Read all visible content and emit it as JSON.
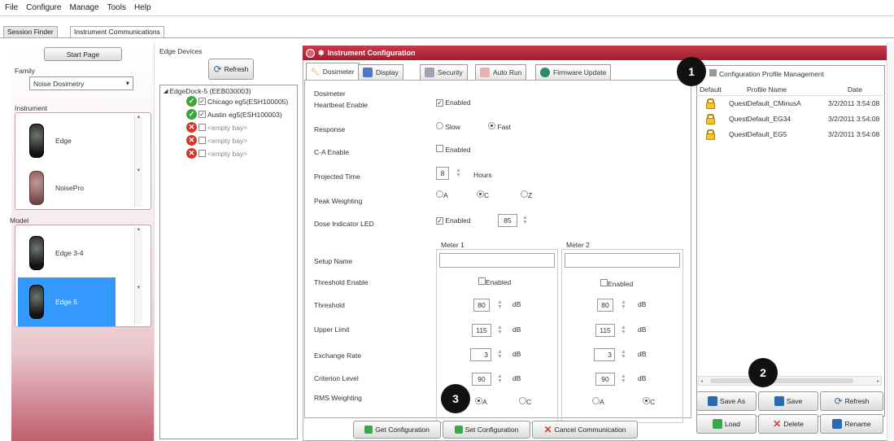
{
  "menu": [
    "File",
    "Configure",
    "Manage",
    "Tools",
    "Help"
  ],
  "tabs": {
    "session_finder": "Session Finder",
    "instrument_comm": "Instrument Communications"
  },
  "left": {
    "start_page": "Start Page",
    "family_label": "Family",
    "family_value": "Noise Dosimetry",
    "instrument_label": "Instrument",
    "instruments": [
      "Edge",
      "NoisePro"
    ],
    "model_label": "Model",
    "models": [
      "Edge 3-4",
      "Edge 5"
    ]
  },
  "edge": {
    "title": "Edge Devices",
    "refresh": "Refresh",
    "dock": "EdgeDock-5 (EEB030003)",
    "bays": [
      {
        "label": "Chicago eg5(ESH100005)",
        "status": "ok",
        "checked": true
      },
      {
        "label": "Austin eg5(ESH100003)",
        "status": "ok",
        "checked": true
      },
      {
        "label": "<empty bay>",
        "status": "error",
        "checked": false
      },
      {
        "label": "<empty bay>",
        "status": "error",
        "checked": false
      },
      {
        "label": "<empty bay>",
        "status": "error",
        "checked": false
      }
    ]
  },
  "config": {
    "title": "Instrument Configuration",
    "tabs": [
      "Dosimeter",
      "Display",
      "Security",
      "Auto Run",
      "Firmware Update"
    ],
    "section": "Dosimeter",
    "heartbeat": {
      "label": "Heartbeat Enable",
      "value": "Enabled"
    },
    "response": {
      "label": "Response",
      "slow": "Slow",
      "fast": "Fast",
      "selected": "Fast"
    },
    "ca": {
      "label": "C-A Enable",
      "value": "Enabled"
    },
    "projected": {
      "label": "Projected Time",
      "value": "8",
      "unit": "Hours"
    },
    "peak": {
      "label": "Peak Weighting",
      "options": [
        "A",
        "C",
        "Z"
      ],
      "selected": "C"
    },
    "dose": {
      "label": "Dose Indicator LED",
      "value": "Enabled",
      "level": "85"
    },
    "meter1": "Meter 1",
    "meter2": "Meter 2",
    "labels": {
      "setup": "Setup Name",
      "threshold_enable": "Threshold Enable",
      "threshold": "Threshold",
      "upper": "Upper Limit",
      "exchange": "Exchange Rate",
      "criterion": "Criterion Level",
      "rms": "RMS Weighting"
    },
    "enabled": "Enabled",
    "db": "dB",
    "m1": {
      "threshold": "80",
      "upper": "115",
      "exchange": "3",
      "criterion": "90",
      "rms_a": "A",
      "rms_c": "C",
      "rms": "A"
    },
    "m2": {
      "threshold": "80",
      "upper": "115",
      "exchange": "3",
      "criterion": "90",
      "rms_a": "A",
      "rms_c": "C",
      "rms": "C"
    },
    "buttons": {
      "get": "Get Configuration",
      "set": "Set Configuration",
      "cancel": "Cancel Communication"
    }
  },
  "profiles": {
    "title": "Configuration Profile Management",
    "cols": [
      "Default",
      "Profile Name",
      "Date"
    ],
    "rows": [
      {
        "name": "QuestDefault_CMinusA",
        "date": "3/2/2011 3:54:08"
      },
      {
        "name": "QuestDefault_EG34",
        "date": "3/2/2011 3:54:08"
      },
      {
        "name": "QuestDefault_EG5",
        "date": "3/2/2011 3:54:08"
      }
    ],
    "buttons": [
      "Save As",
      "Save",
      "Refresh",
      "Load",
      "Delete",
      "Rename"
    ]
  },
  "callouts": [
    "1",
    "2",
    "3"
  ],
  "colors": {
    "titlebar": "#b22a3a",
    "accent": "#3399ff",
    "panel": "#c0606d"
  }
}
